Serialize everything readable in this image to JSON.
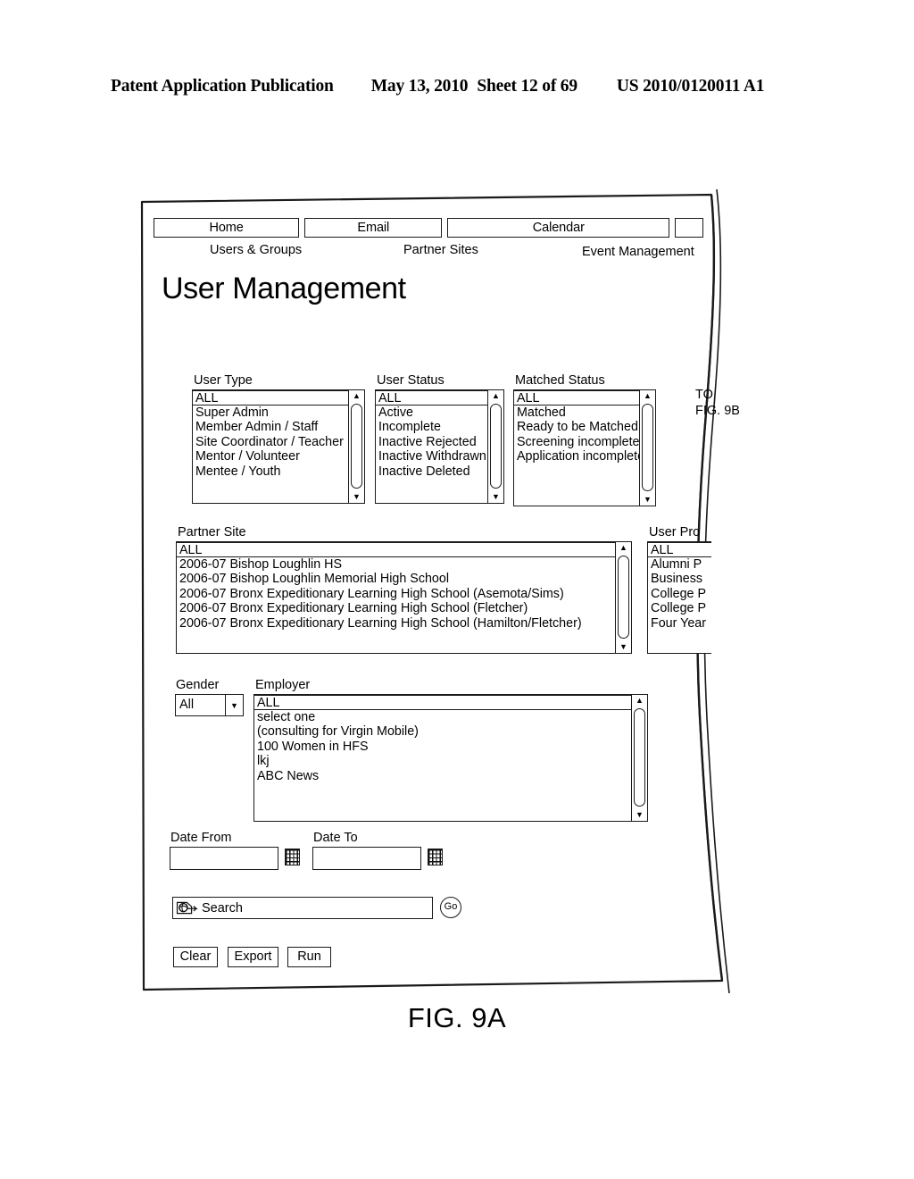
{
  "header": {
    "publication": "Patent Application Publication",
    "date": "May 13, 2010",
    "sheet": "Sheet 12 of 69",
    "number": "US 2010/0120011 A1"
  },
  "figure": {
    "caption": "FIG. 9A",
    "continuation_note_line1": "TO",
    "continuation_note_line2": "FIG. 9B"
  },
  "screen": {
    "tabs": [
      {
        "label": "Home"
      },
      {
        "label": "Email"
      },
      {
        "label": "Calendar"
      },
      {
        "label": ""
      }
    ],
    "subnav": [
      {
        "label": "Users & Groups"
      },
      {
        "label": "Partner Sites"
      },
      {
        "label": "Event Management"
      }
    ],
    "title": "User Management",
    "filters": {
      "user_type": {
        "label": "User Type",
        "selected": "ALL",
        "options": [
          "ALL",
          "Super Admin",
          "Member Admin / Staff",
          "Site Coordinator / Teacher",
          "Mentor / Volunteer",
          "Mentee / Youth"
        ]
      },
      "user_status": {
        "label": "User Status",
        "selected": "ALL",
        "options": [
          "ALL",
          "Active",
          "Incomplete",
          "Inactive Rejected",
          "Inactive Withdrawn",
          "Inactive Deleted"
        ]
      },
      "matched_status": {
        "label": "Matched Status",
        "selected": "ALL",
        "options": [
          "ALL",
          "Matched",
          "Ready to be Matched",
          "Screening incomplete",
          "Application incomplete"
        ]
      },
      "partner_site": {
        "label": "Partner Site",
        "selected": "ALL",
        "options": [
          "ALL",
          "2006-07 Bishop Loughlin HS",
          "2006-07 Bishop Loughlin Memorial High School",
          "2006-07 Bronx Expeditionary Learning High School (Asemota/Sims)",
          "2006-07 Bronx Expeditionary Learning High School (Fletcher)",
          "2006-07 Bronx Expeditionary Learning High School (Hamilton/Fletcher)"
        ]
      },
      "user_profile": {
        "label": "User Pro",
        "selected": "ALL",
        "options": [
          "ALL",
          "Alumni P",
          "Business",
          "College P",
          "College P",
          "Four Year"
        ]
      },
      "gender": {
        "label": "Gender",
        "selected": "All"
      },
      "employer": {
        "label": "Employer",
        "selected": "ALL",
        "options": [
          "ALL",
          "select one",
          "(consulting for Virgin Mobile)",
          "100 Women in HFS",
          "lkj",
          "ABC News"
        ]
      },
      "date_from": {
        "label": "Date From",
        "value": ""
      },
      "date_to": {
        "label": "Date To",
        "value": ""
      }
    },
    "search": {
      "placeholder": "Search",
      "value": "Search",
      "icon": "search-globe-icon",
      "go_label": "Go"
    },
    "actions": [
      {
        "label": "Clear"
      },
      {
        "label": "Export"
      },
      {
        "label": "Run"
      }
    ],
    "scroll_icons": {
      "up": "▲",
      "down": "▼",
      "dropdown": "▼"
    }
  }
}
